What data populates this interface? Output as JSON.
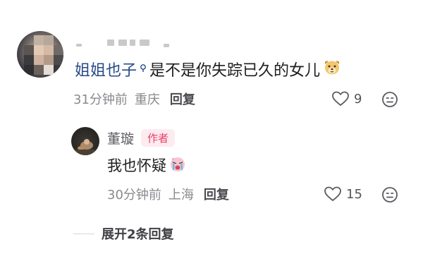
{
  "top_comment": {
    "author_name": "姐姐也子",
    "text": "是不是你失踪已久的女儿",
    "time": "31分钟前",
    "location": "重庆",
    "reply_label": "回复",
    "like_count": "9",
    "emoji_icon": "dog-face-emoji-icon"
  },
  "reply_comment": {
    "author_name": "董璇",
    "badge_label": "作者",
    "text": "我也怀疑",
    "time": "30分钟前",
    "location": "上海",
    "reply_label": "回复",
    "like_count": "15",
    "emoji_icon": "crying-face-emoji-icon"
  },
  "expand": {
    "label": "展开2条回复"
  },
  "colors": {
    "author_link": "#274a86",
    "badge_text": "#e9416b",
    "badge_bg": "#fdebef",
    "meta_text": "#8a8a8f"
  }
}
